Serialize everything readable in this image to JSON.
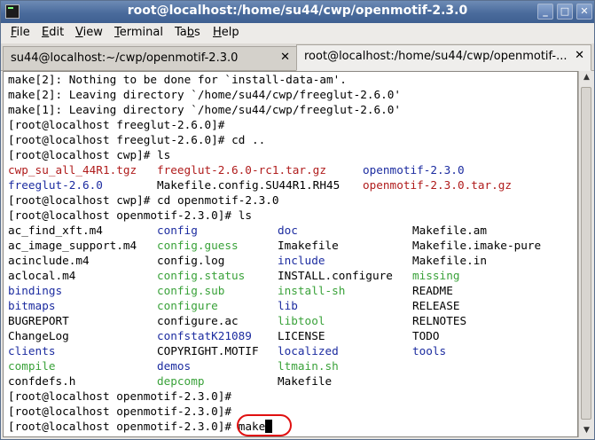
{
  "window": {
    "title": "root@localhost:/home/su44/cwp/openmotif-2.3.0"
  },
  "menu": [
    "File",
    "Edit",
    "View",
    "Terminal",
    "Tabs",
    "Help"
  ],
  "menu_underline": [
    "F",
    "E",
    "V",
    "T",
    "b",
    "H"
  ],
  "tabs": [
    {
      "label": "su44@localhost:~/cwp/openmotif-2.3.0",
      "close": "✕"
    },
    {
      "label": "root@localhost:/home/su44/cwp/openmotif-...",
      "close": "✕"
    }
  ],
  "terminal": {
    "lines": [
      "make[2]: Nothing to be done for `install-data-am'.",
      "make[2]: Leaving directory `/home/su44/cwp/freeglut-2.6.0'",
      "make[1]: Leaving directory `/home/su44/cwp/freeglut-2.6.0'",
      "[root@localhost freeglut-2.6.0]#",
      "[root@localhost freeglut-2.6.0]# cd ..",
      "[root@localhost cwp]# ls"
    ],
    "ls1": [
      [
        {
          "t": "cwp_su_all_44R1.tgz",
          "c": "red"
        },
        {
          "t": "freeglut-2.6.0-rc1.tar.gz",
          "c": "red"
        },
        {
          "t": "openmotif-2.3.0",
          "c": "blue"
        }
      ],
      [
        {
          "t": "freeglut-2.6.0",
          "c": "blue"
        },
        {
          "t": "Makefile.config.SU44R1.RH45",
          "c": ""
        },
        {
          "t": "openmotif-2.3.0.tar.gz",
          "c": "red"
        }
      ]
    ],
    "lines2": [
      "[root@localhost cwp]# cd openmotif-2.3.0",
      "[root@localhost openmotif-2.3.0]# ls"
    ],
    "ls2": [
      [
        {
          "t": "ac_find_xft.m4",
          "c": ""
        },
        {
          "t": "config",
          "c": "blue"
        },
        {
          "t": "doc",
          "c": "blue"
        },
        {
          "t": "Makefile.am",
          "c": ""
        }
      ],
      [
        {
          "t": "ac_image_support.m4",
          "c": ""
        },
        {
          "t": "config.guess",
          "c": "green"
        },
        {
          "t": "Imakefile",
          "c": ""
        },
        {
          "t": "Makefile.imake-pure",
          "c": ""
        }
      ],
      [
        {
          "t": "acinclude.m4",
          "c": ""
        },
        {
          "t": "config.log",
          "c": ""
        },
        {
          "t": "include",
          "c": "blue"
        },
        {
          "t": "Makefile.in",
          "c": ""
        }
      ],
      [
        {
          "t": "aclocal.m4",
          "c": ""
        },
        {
          "t": "config.status",
          "c": "green"
        },
        {
          "t": "INSTALL.configure",
          "c": ""
        },
        {
          "t": "missing",
          "c": "green"
        }
      ],
      [
        {
          "t": "bindings",
          "c": "blue"
        },
        {
          "t": "config.sub",
          "c": "green"
        },
        {
          "t": "install-sh",
          "c": "green"
        },
        {
          "t": "README",
          "c": ""
        }
      ],
      [
        {
          "t": "bitmaps",
          "c": "blue"
        },
        {
          "t": "configure",
          "c": "green"
        },
        {
          "t": "lib",
          "c": "blue"
        },
        {
          "t": "RELEASE",
          "c": ""
        }
      ],
      [
        {
          "t": "BUGREPORT",
          "c": ""
        },
        {
          "t": "configure.ac",
          "c": ""
        },
        {
          "t": "libtool",
          "c": "green"
        },
        {
          "t": "RELNOTES",
          "c": ""
        }
      ],
      [
        {
          "t": "ChangeLog",
          "c": ""
        },
        {
          "t": "confstatK21089",
          "c": "blue"
        },
        {
          "t": "LICENSE",
          "c": ""
        },
        {
          "t": "TODO",
          "c": ""
        }
      ],
      [
        {
          "t": "clients",
          "c": "blue"
        },
        {
          "t": "COPYRIGHT.MOTIF",
          "c": ""
        },
        {
          "t": "localized",
          "c": "blue"
        },
        {
          "t": "tools",
          "c": "blue"
        }
      ],
      [
        {
          "t": "compile",
          "c": "green"
        },
        {
          "t": "demos",
          "c": "blue"
        },
        {
          "t": "ltmain.sh",
          "c": "green"
        },
        {
          "t": "",
          "c": ""
        }
      ],
      [
        {
          "t": "confdefs.h",
          "c": ""
        },
        {
          "t": "depcomp",
          "c": "green"
        },
        {
          "t": "Makefile",
          "c": ""
        },
        {
          "t": "",
          "c": ""
        }
      ]
    ],
    "lines3": [
      "[root@localhost openmotif-2.3.0]#",
      "[root@localhost openmotif-2.3.0]#"
    ],
    "prompt": "[root@localhost openmotif-2.3.0]# ",
    "command": "make"
  },
  "colors": {
    "red": "#b01c1c",
    "blue": "#1c2ca0",
    "green": "#3aa23a",
    "highlight": "#e01010"
  }
}
